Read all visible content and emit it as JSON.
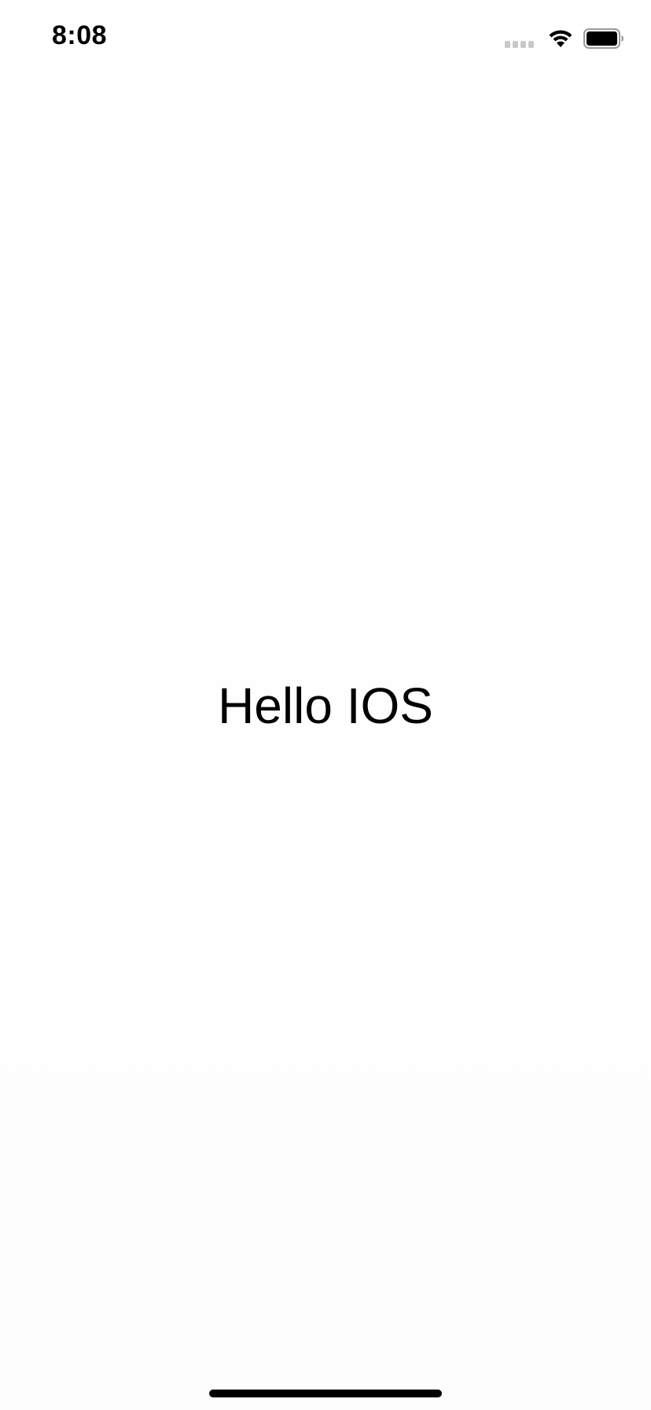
{
  "status_bar": {
    "time": "8:08",
    "icons": [
      "cellular-signal-icon",
      "wifi-icon",
      "battery-icon"
    ]
  },
  "main": {
    "label": "Hello IOS"
  },
  "colors": {
    "background": "#ffffff",
    "text": "#000000",
    "signal_inactive": "#c9c9c9"
  }
}
